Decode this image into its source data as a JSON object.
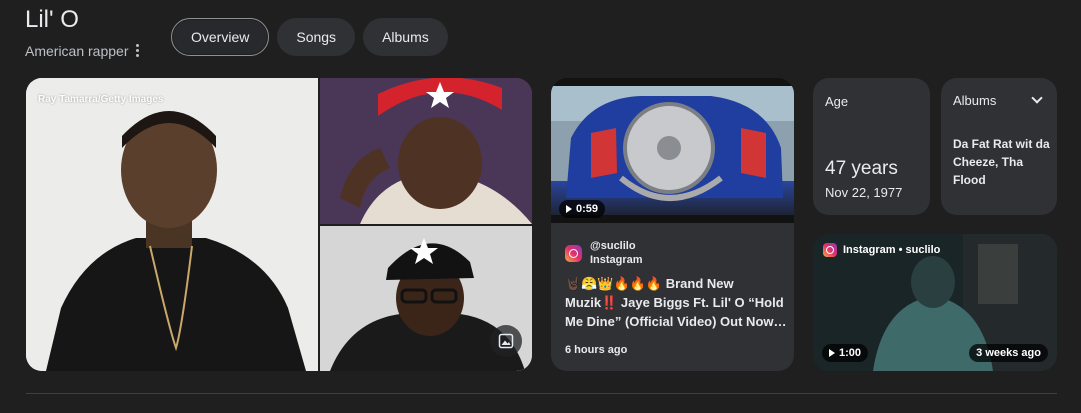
{
  "header": {
    "title": "Lil' O",
    "subtitle": "American rapper"
  },
  "tabs": [
    {
      "label": "Overview",
      "active": true
    },
    {
      "label": "Songs",
      "active": false
    },
    {
      "label": "Albums",
      "active": false
    }
  ],
  "photos": {
    "credit": "Ray Tamarra/Getty Images"
  },
  "video1": {
    "duration": "0:59",
    "handle": "@suclilo",
    "platform": "Instagram",
    "caption": "🤘🏿😤👑🔥🔥🔥 Brand New Muzik‼️ Jaye Biggs Ft. Lil' O “Hold Me Dine” (Official Video) Out Now…",
    "time_ago": "6 hours ago"
  },
  "age_card": {
    "label": "Age",
    "value": "47 years",
    "date": "Nov 22, 1977"
  },
  "albums_card": {
    "label": "Albums",
    "text": "Da Fat Rat wit da Cheeze, Tha Flood"
  },
  "video2": {
    "source": "Instagram • suclilo",
    "duration": "1:00",
    "time_ago": "3 weeks ago"
  },
  "colors": {
    "background": "#1f1f1f",
    "card": "#303134",
    "text": "#e8eaed",
    "subtext": "#bdc1c6"
  }
}
